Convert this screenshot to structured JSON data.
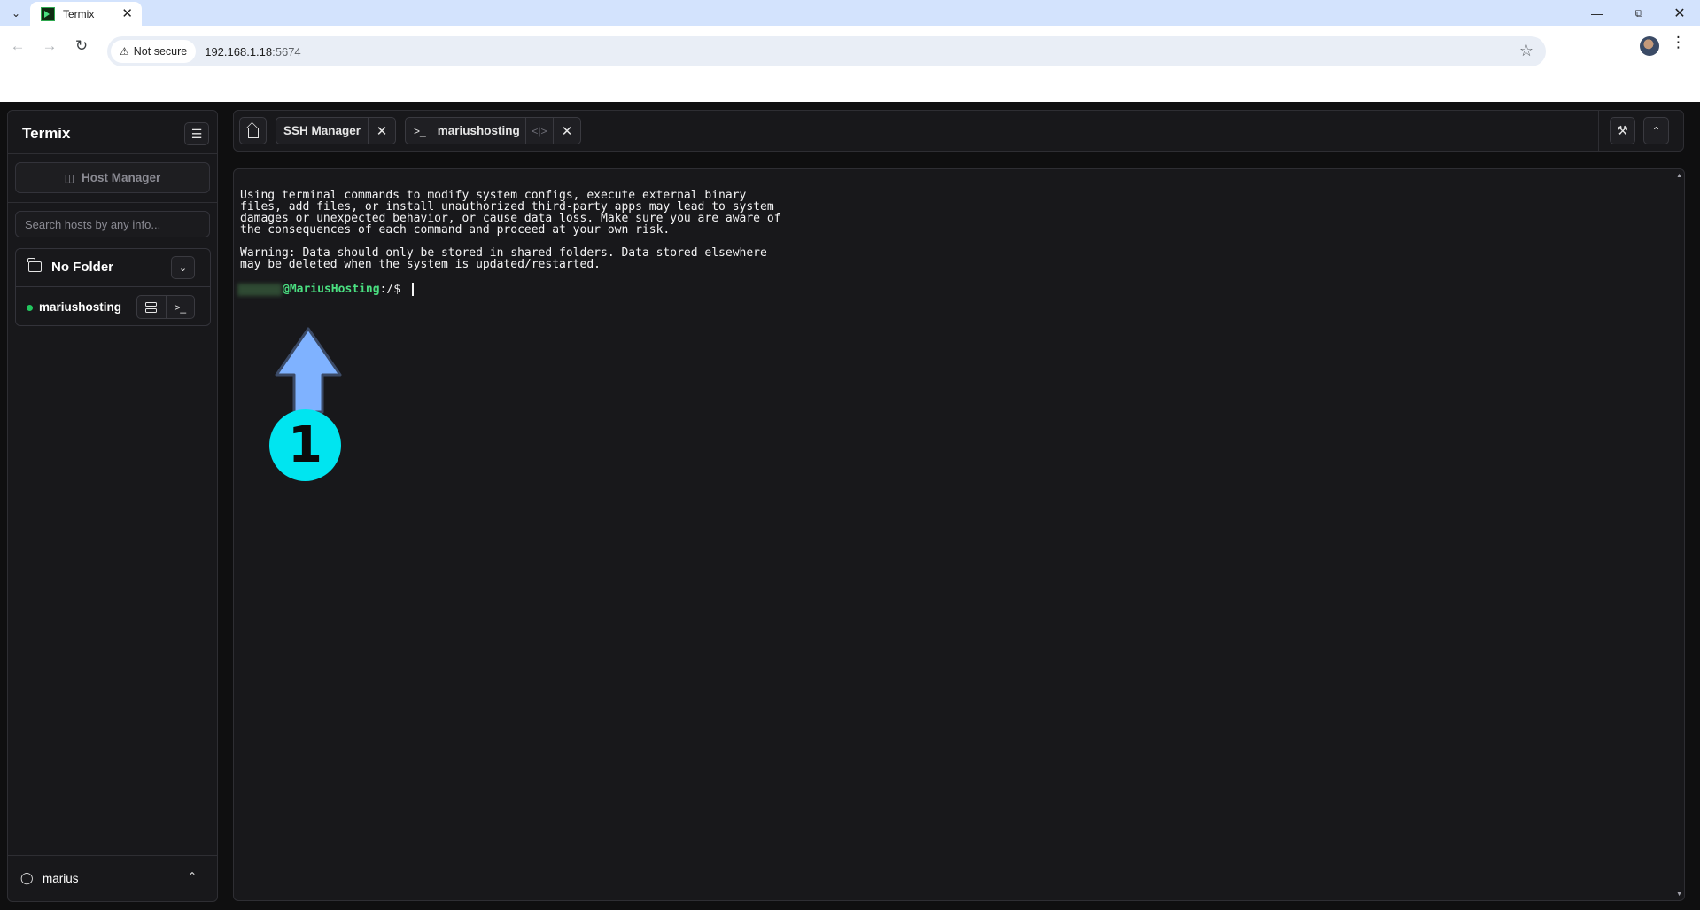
{
  "browser": {
    "tab_title": "Termix",
    "security_label": "Not secure",
    "url_host": "192.168.1.18",
    "url_port": ":5674"
  },
  "sidebar": {
    "brand": "Termix",
    "host_manager_label": "Host Manager",
    "search_placeholder": "Search hosts by any info...",
    "folder": {
      "name": "No Folder",
      "hosts": [
        {
          "name": "mariushosting",
          "status": "online",
          "status_color": "#22c55e"
        }
      ]
    },
    "user": {
      "name": "marius"
    }
  },
  "topbar": {
    "tabs": [
      {
        "label": "SSH Manager"
      },
      {
        "label": "mariushosting",
        "icon": "terminal-icon"
      }
    ]
  },
  "terminal": {
    "lines": [
      "Using terminal commands to modify system configs, execute external binary",
      "files, add files, or install unauthorized third-party apps may lead to system",
      "damages or unexpected behavior, or cause data loss. Make sure you are aware of",
      "the consequences of each command and proceed at your own risk.",
      "",
      "Warning: Data should only be stored in shared folders. Data stored elsewhere",
      "may be deleted when the system is updated/restarted."
    ],
    "prompt_host": "@MariusHosting",
    "prompt_path": ":/$ "
  },
  "annotation": {
    "step_number": "1",
    "arrow_color": "#7fb2ff",
    "badge_color": "#00e5f0"
  }
}
